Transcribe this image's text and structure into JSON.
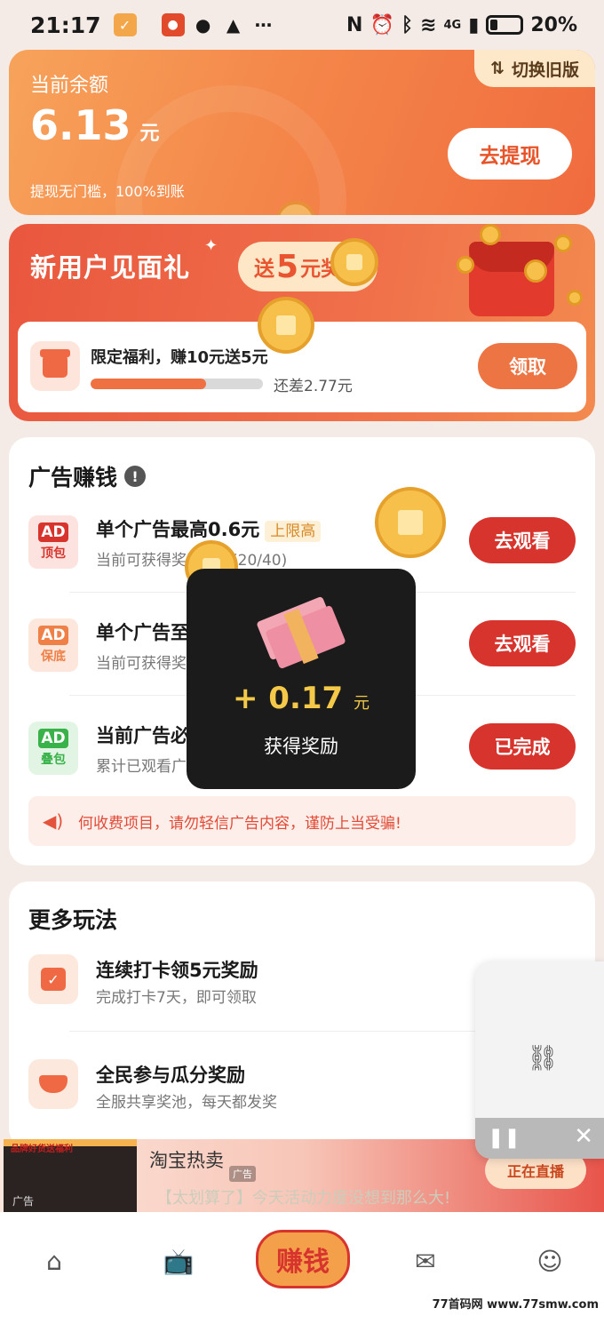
{
  "status": {
    "time": "21:17",
    "battery": "20%",
    "network": "4G"
  },
  "balance": {
    "label": "当前余额",
    "amount": "6.13",
    "unit": "元",
    "note": "提现无门槛，100%到账",
    "switch_label": "切换旧版",
    "withdraw_label": "去提现"
  },
  "newuser": {
    "title": "新用户见面礼",
    "bubble_prefix": "送",
    "bubble_num": "5",
    "bubble_suffix": "元奖励",
    "task_title": "限定福利，赚10元送5元",
    "progress": 0.67,
    "remain": "还差2.77元",
    "claim_label": "领取"
  },
  "ads": {
    "title": "广告赚钱",
    "rows": [
      {
        "badge": "AD",
        "sub": "顶包",
        "title": "单个广告最高0.6元",
        "tag": "上限高",
        "desc": "当前可获得奖励次数(20/40)",
        "button": "去观看",
        "color": "#d8342e",
        "bg": "#fde3df"
      },
      {
        "badge": "AD",
        "sub": "保底",
        "title": "单个广告至少得0.1元",
        "tag": "",
        "desc": "当前可获得奖励次数(18/",
        "button": "去观看",
        "color": "#ef8148",
        "bg": "#fde6dc"
      },
      {
        "badge": "AD",
        "sub": "叠包",
        "title": "当前广告必得0.5元",
        "tag": "",
        "desc": "累计已观看广告次数(1/1)",
        "button": "已完成",
        "color": "#39b24a",
        "bg": "#e2f5e4"
      }
    ],
    "notice": "何收费项目，请勿轻信广告内容，谨防上当受骗!"
  },
  "more": {
    "title": "更多玩法",
    "rows": [
      {
        "title": "连续打卡领5元奖励",
        "desc": "完成打卡7天，即可领取"
      },
      {
        "title": "全民参与瓜分奖励",
        "desc": "全服共享奖池，每天都发奖"
      }
    ]
  },
  "toast": {
    "amount": "+ 0.17",
    "unit": "元",
    "label": "获得奖励"
  },
  "banner": {
    "title": "淘宝热卖",
    "ad_label": "广告",
    "sub": "【太划算了】今天活动力度没想到那么大!",
    "thumb_tag": "品牌好货送福利",
    "thumb_ad": "广告",
    "live_label": "正在直播"
  },
  "tabbar": {
    "earn_label": "赚钱"
  },
  "watermark": "77首码网 www.77smw.com"
}
